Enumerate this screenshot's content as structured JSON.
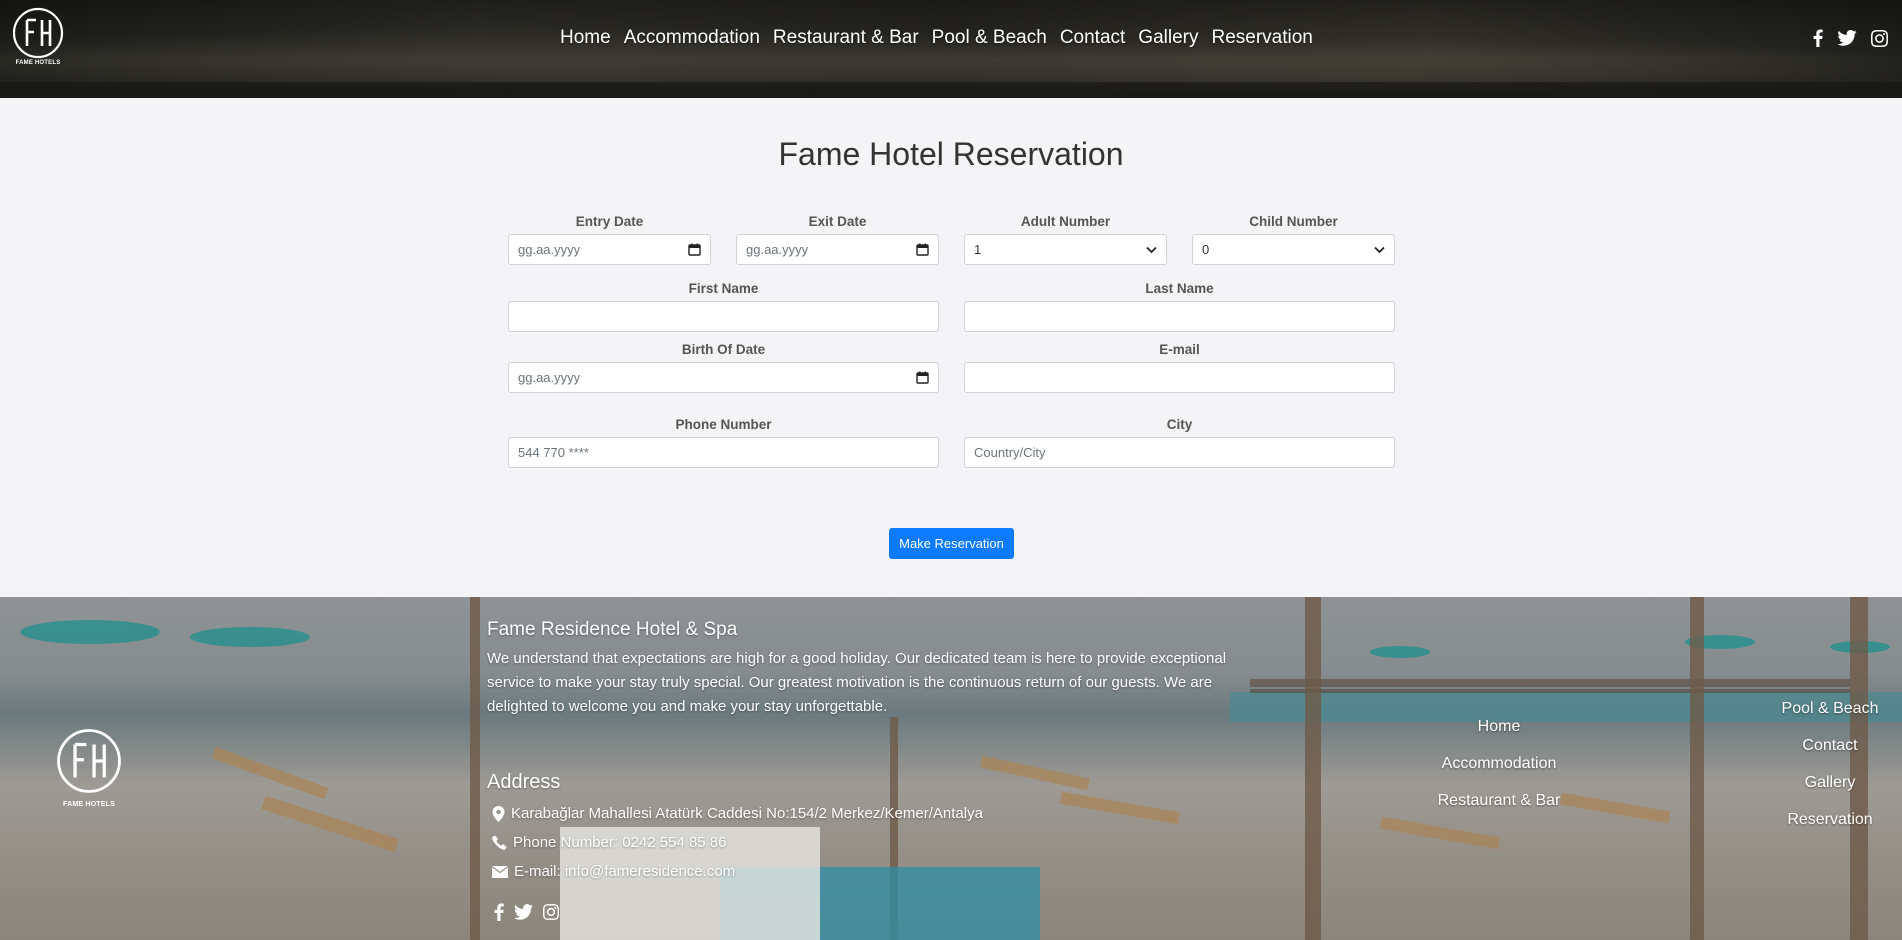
{
  "header": {
    "logo_text": "FAME HOTELS",
    "nav": [
      "Home",
      "Accommodation",
      "Restaurant & Bar",
      "Pool & Beach",
      "Contact",
      "Gallery",
      "Reservation"
    ],
    "social": [
      "facebook-icon",
      "twitter-icon",
      "instagram-icon"
    ]
  },
  "main": {
    "title": "Fame Hotel Reservation",
    "form": {
      "entry_date": {
        "label": "Entry Date",
        "placeholder": "gg.aa.yyyy"
      },
      "exit_date": {
        "label": "Exit Date",
        "placeholder": "gg.aa.yyyy"
      },
      "adult_number": {
        "label": "Adult Number",
        "value": "1"
      },
      "child_number": {
        "label": "Child Number",
        "value": "0"
      },
      "first_name": {
        "label": "First Name",
        "value": ""
      },
      "last_name": {
        "label": "Last Name",
        "value": ""
      },
      "birth_date": {
        "label": "Birth Of Date",
        "placeholder": "gg.aa.yyyy"
      },
      "email": {
        "label": "E-mail",
        "value": ""
      },
      "phone": {
        "label": "Phone Number",
        "placeholder": "544 770 ****"
      },
      "city": {
        "label": "City",
        "placeholder": "Country/City"
      }
    },
    "submit_label": "Make Reservation"
  },
  "footer": {
    "logo_text": "FAME HOTELS",
    "title": "Fame Residence Hotel & Spa",
    "description": "We understand that expectations are high for a good holiday. Our dedicated team is here to provide exceptional service to make your stay truly special. Our greatest motivation is the continuous return of our guests. We are delighted to welcome you and make your stay unforgettable.",
    "address_title": "Address",
    "address": "Karabağlar Mahallesi Atatürk Caddesi No:154/2 Merkez/Kemer/Antalya",
    "phone": "Phone Number: 0242 554 85 86",
    "email": "E-mail: info@fameresidence.com",
    "links_col1": [
      "Home",
      "Accommodation",
      "Restaurant & Bar"
    ],
    "links_col2": [
      "Pool & Beach",
      "Contact",
      "Gallery",
      "Reservation"
    ],
    "colors": {
      "accent": "#0d7bff"
    }
  }
}
